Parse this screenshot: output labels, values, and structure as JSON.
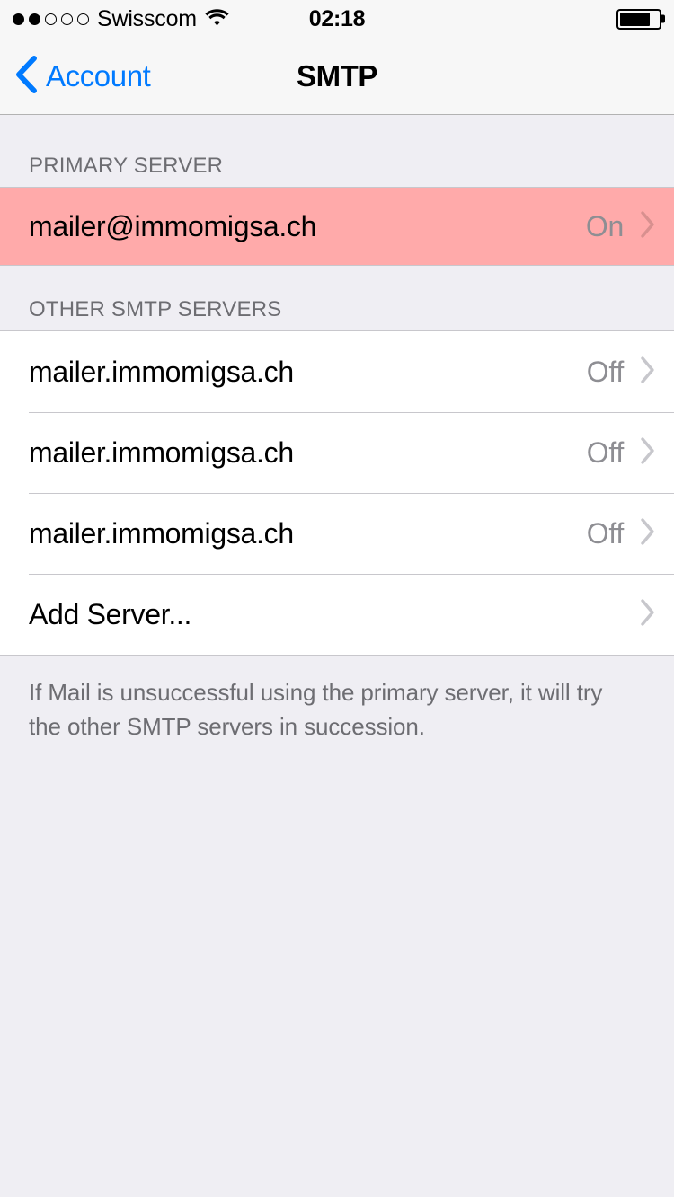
{
  "status_bar": {
    "carrier": "Swisscom",
    "time": "02:18",
    "signal_bars_filled": 2,
    "signal_bars_total": 5,
    "wifi_icon": "wifi-icon",
    "battery_icon": "battery-icon",
    "battery_level_percent": 78
  },
  "nav_bar": {
    "back_label": "Account",
    "back_icon": "chevron-left-icon",
    "title": "SMTP"
  },
  "sections": {
    "primary": {
      "header": "PRIMARY SERVER",
      "rows": [
        {
          "title": "mailer@immomigsa.ch",
          "value": "On",
          "accessory": "chevron-right-icon",
          "highlighted": true
        }
      ]
    },
    "other": {
      "header": "OTHER SMTP SERVERS",
      "rows": [
        {
          "title": "mailer.immomigsa.ch",
          "value": "Off",
          "accessory": "chevron-right-icon",
          "highlighted": false
        },
        {
          "title": "mailer.immomigsa.ch",
          "value": "Off",
          "accessory": "chevron-right-icon",
          "highlighted": false
        },
        {
          "title": "mailer.immomigsa.ch",
          "value": "Off",
          "accessory": "chevron-right-icon",
          "highlighted": false
        },
        {
          "title": "Add Server...",
          "value": "",
          "accessory": "chevron-right-icon",
          "highlighted": false
        }
      ]
    }
  },
  "footer_note": "If Mail is unsuccessful using the primary server, it will try the other SMTP servers in succession.",
  "colors": {
    "accent_blue": "#007aff",
    "highlight_pink": "#ffaaaa",
    "background": "#efeef3",
    "row_background": "#ffffff",
    "secondary_text": "#8e8e93",
    "header_text": "#6d6d72",
    "separator": "#c8c7cc"
  }
}
